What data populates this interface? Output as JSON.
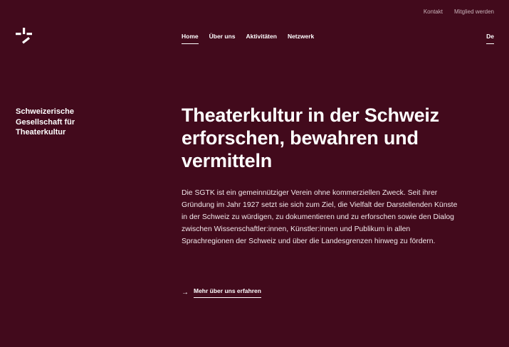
{
  "utility_nav": {
    "contact": "Kontakt",
    "join": "Mitglied werden"
  },
  "main_nav": {
    "items": [
      {
        "label": "Home",
        "active": true
      },
      {
        "label": "Über uns",
        "active": false
      },
      {
        "label": "Aktivitäten",
        "active": false
      },
      {
        "label": "Netzwerk",
        "active": false
      }
    ]
  },
  "language": "De",
  "logo_icon": "sgtk-logo-icon",
  "org_name": "Schweizerische Gesellschaft für Theaterkultur",
  "headline": "Theaterkultur in der Schweiz erforschen, bewahren und vermitteln",
  "intro": "Die SGTK ist ein gemeinnütziger Verein ohne kommerziellen Zweck. Seit ihrer Gründung im Jahr 1927 setzt sie sich zum Ziel, die Vielfalt der Darstellenden Künste in der Schweiz zu würdigen, zu dokumentieren und zu erforschen sowie den Dialog zwischen Wissenschaftler:innen, Künstler:innen und Publikum in allen Sprachregionen der Schweiz und über die Landesgrenzen hinweg zu fördern.",
  "more_link": {
    "arrow": "→",
    "label": "Mehr über uns erfahren"
  },
  "colors": {
    "background": "#420a1c",
    "text": "#ffffff",
    "muted": "#c9b3ba"
  }
}
